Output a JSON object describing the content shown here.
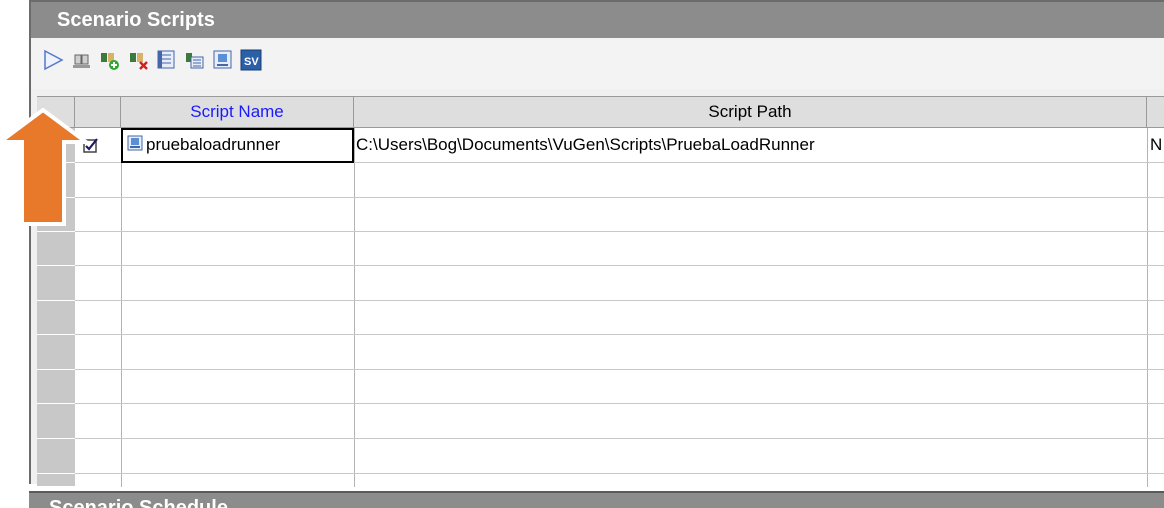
{
  "panel": {
    "title": "Scenario Scripts"
  },
  "toolbar": {
    "buttons": [
      {
        "icon": "play-icon"
      },
      {
        "icon": "users-icon"
      },
      {
        "icon": "add-script-icon"
      },
      {
        "icon": "remove-script-icon"
      },
      {
        "icon": "script-details-icon"
      },
      {
        "icon": "script-view-icon"
      },
      {
        "icon": "runtime-settings-icon"
      },
      {
        "icon": "sv-icon",
        "label": "SV"
      }
    ]
  },
  "table": {
    "columns": [
      "",
      "",
      "Script Name",
      "Script Path",
      ""
    ],
    "rows": [
      {
        "name": "pruebaloadrunner",
        "path": "C:\\Users\\Bog\\Documents\\VuGen\\Scripts\\PruebaLoadRunner",
        "extra": "N"
      }
    ]
  },
  "bottom_panel": {
    "title": "Scenario Schedule"
  },
  "colors": {
    "title_bar": "#8c8c8c",
    "accent_header": "#1a1aff",
    "arrow": "#e8782a"
  }
}
